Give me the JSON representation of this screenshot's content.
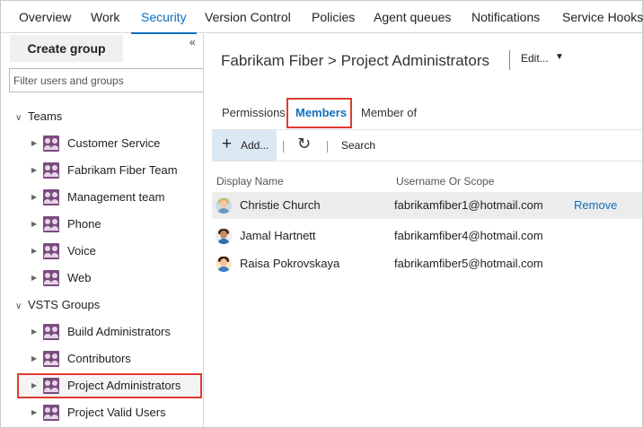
{
  "topnav": {
    "tabs": [
      "Overview",
      "Work",
      "Security",
      "Version Control",
      "Policies",
      "Agent queues",
      "Notifications",
      "Service Hooks"
    ],
    "active": "Security"
  },
  "left": {
    "create_group": "Create group",
    "collapse_icon": "«",
    "filter_placeholder": "Filter users and groups",
    "teams_heading": "Teams",
    "teams": [
      "Customer Service",
      "Fabrikam Fiber Team",
      "Management team",
      "Phone",
      "Voice",
      "Web"
    ],
    "vsts_heading": "VSTS Groups",
    "groups": [
      "Build Administrators",
      "Contributors",
      "Project Administrators",
      "Project Valid Users"
    ],
    "selected": "Project Administrators"
  },
  "right": {
    "breadcrumb": "Fabrikam Fiber > Project Administrators",
    "edit": "Edit...",
    "tabs": {
      "permissions": "Permissions",
      "members": "Members",
      "member_of": "Member of"
    },
    "active_tab": "Members",
    "toolbar": {
      "add": "Add...",
      "search": "Search"
    },
    "columns": {
      "display_name": "Display Name",
      "username": "Username Or Scope"
    },
    "members": [
      {
        "name": "Christie Church",
        "email": "fabrikamfiber1@hotmail.com",
        "action": "Remove"
      },
      {
        "name": "Jamal Hartnett",
        "email": "fabrikamfiber4@hotmail.com",
        "action": ""
      },
      {
        "name": "Raisa Pokrovskaya",
        "email": "fabrikamfiber5@hotmail.com",
        "action": ""
      }
    ]
  },
  "colors": {
    "accent": "#106ebe",
    "highlight_box": "#e03b2f",
    "group_icon": "#7a4c7e",
    "add_button_bg": "#dbe9f5"
  },
  "icons": [
    "group-icon",
    "plus-icon",
    "refresh-icon",
    "chevron-down-icon",
    "avatar-icon"
  ]
}
